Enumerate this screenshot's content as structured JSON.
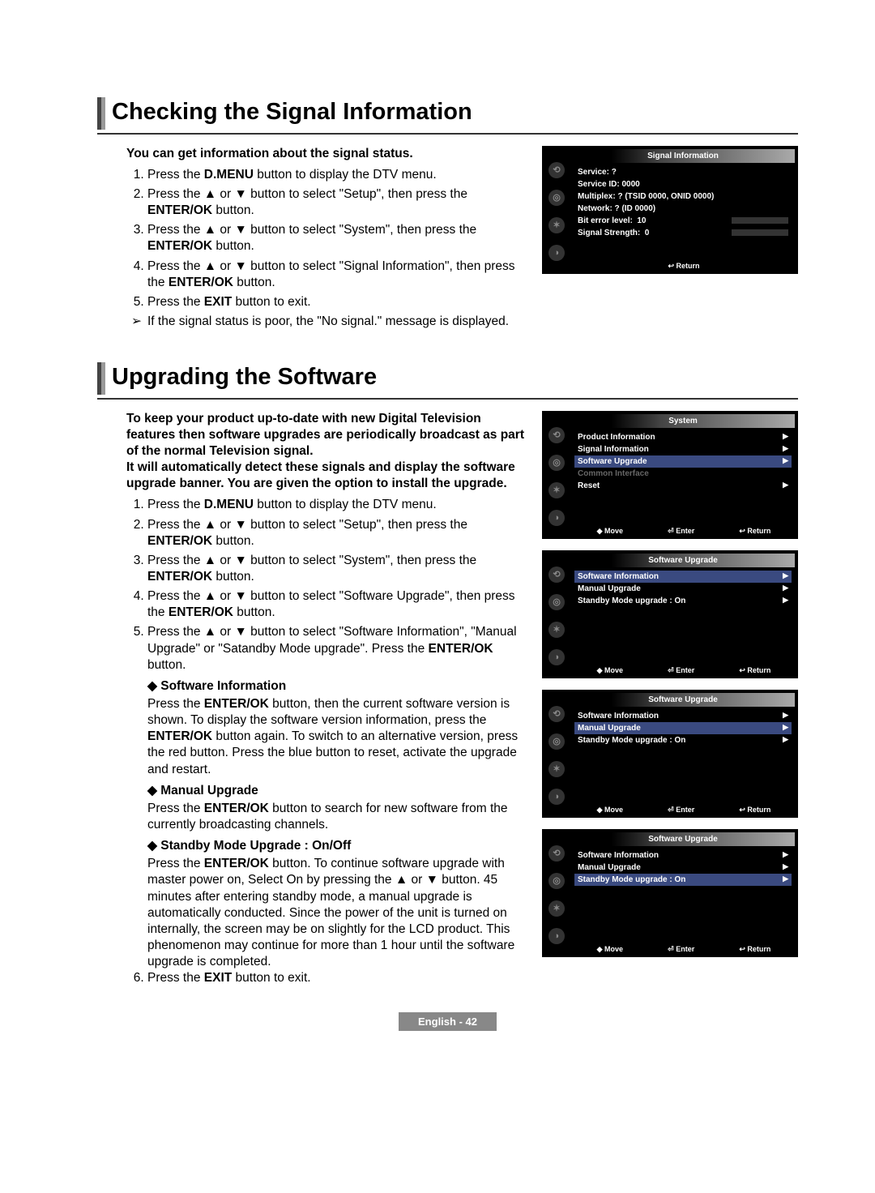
{
  "sec1": {
    "title": "Checking the Signal Information",
    "intro": "You can get information about the signal status.",
    "steps": [
      "Press the <b>D.MENU</b> button to display the DTV menu.",
      "Press the ▲ or ▼ button to select \"Setup\", then press the <b>ENTER/OK</b> button.",
      "Press the ▲ or ▼ button to select \"System\", then press the <b>ENTER/OK</b> button.",
      "Press the ▲ or ▼ button to select \"Signal Information\", then press the <b>ENTER/OK</b> button.",
      "Press the <b>EXIT</b> button to exit."
    ],
    "note": "If the signal status is poor, the \"No signal.\" message is displayed."
  },
  "osd_signal": {
    "title": "Signal Information",
    "lines": [
      "Service: ?",
      "Service ID: 0000",
      "Multiplex: ? (TSID 0000, ONID 0000)",
      "Network: ? (ID 0000)"
    ],
    "bit_label": "Bit error level:",
    "bit_val": "10",
    "str_label": "Signal Strength:",
    "str_val": "0",
    "return": "↩ Return"
  },
  "sec2": {
    "title": "Upgrading the Software",
    "intro": "To keep your product up-to-date with new Digital Television features then software upgrades are periodically broadcast as part of the normal Television signal.\nIt will automatically detect these signals and display the software upgrade banner. You are given the option to install the upgrade.",
    "steps": [
      "Press the <b>D.MENU</b> button to display the DTV menu.",
      "Press the ▲ or ▼ button to select \"Setup\", then press the <b>ENTER/OK</b> button.",
      "Press the ▲ or ▼ button to select \"System\", then press the <b>ENTER/OK</b> button.",
      "Press the ▲ or ▼ button to select \"Software Upgrade\", then press the <b>ENTER/OK</b> button.",
      "Press the ▲ or ▼ button to select \"Software Information\", \"Manual Upgrade\" or \"Satandby Mode upgrade\". Press the <b>ENTER/OK</b> button."
    ],
    "sub_sw_head": "Software Information",
    "sub_sw_body": "Press the <b>ENTER/OK</b> button, then the current software version is shown. To display the software version information, press the <b>ENTER/OK</b> button again. To switch to an alternative version, press the red button. Press the blue button to reset, activate the upgrade and restart.",
    "sub_mu_head": "Manual Upgrade",
    "sub_mu_body": "Press the <b>ENTER/OK</b> button to search for new software from the currently broadcasting channels.",
    "sub_sb_head": "Standby Mode Upgrade : On/Off",
    "sub_sb_body": "Press the <b>ENTER/OK</b> button. To continue software upgrade with master power on, Select On by pressing the ▲ or ▼ button. 45 minutes after entering standby mode, a manual upgrade is automatically conducted. Since the power of the unit is turned on internally, the screen may be on slightly for the LCD product. This phenomenon may continue for more than 1 hour until the software upgrade is completed.",
    "step6": "Press the <b>EXIT</b> button to exit."
  },
  "osd_system": {
    "title": "System",
    "items": [
      "Product Information",
      "Signal Information",
      "Software Upgrade",
      "Common Interface",
      "Reset"
    ],
    "sel": 2,
    "move": "◆ Move",
    "enter": "⏎ Enter",
    "return": "↩ Return"
  },
  "osd_swup": {
    "title": "Software Upgrade",
    "items": [
      "Software Information",
      "Manual Upgrade",
      "Standby Mode upgrade : On"
    ],
    "move": "◆ Move",
    "enter": "⏎ Enter",
    "return": "↩ Return"
  },
  "footer": "English - 42"
}
